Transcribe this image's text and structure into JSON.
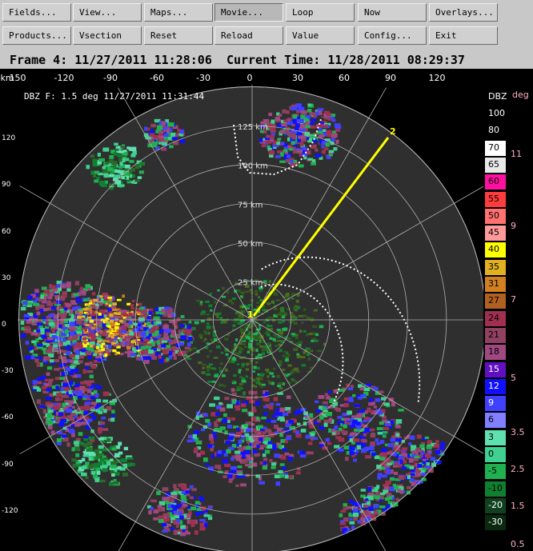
{
  "toolbar": {
    "row1": [
      "Fields...",
      "View...",
      "Maps...",
      "Movie...",
      "Loop",
      "Now",
      "Overlays..."
    ],
    "row2": [
      "Products...",
      "Vsection",
      "Reset",
      "Reload",
      "Value",
      "Config...",
      "Exit"
    ]
  },
  "frame": {
    "label": "Frame 4: 11/27/2011 11:28:06",
    "current_time": "Current Time: 11/28/2011 08:29:37"
  },
  "plot": {
    "title": "DBZ F: 1.5 deg 11/27/2011 11:31:44",
    "unit_label": "km",
    "x_ticks": [
      "150",
      "-120",
      "-90",
      "-60",
      "-30",
      "0",
      "30",
      "60",
      "90",
      "120"
    ],
    "y_ticks": [
      "120",
      "90",
      "60",
      "30",
      "0",
      "-30",
      "-60",
      "-90",
      "-120"
    ],
    "range_rings": [
      "25 km",
      "50 km",
      "75 km",
      "100 km",
      "125 km"
    ],
    "vsection_points": [
      "1",
      "2"
    ]
  },
  "legend": {
    "field": "DBZ",
    "field2": "deg",
    "entries": [
      {
        "label": "100",
        "color": "#000000",
        "text": "#ffffff"
      },
      {
        "label": "80",
        "color": "#000000",
        "text": "#ffffff"
      },
      {
        "label": "70",
        "color": "#ffffff",
        "text": "#000000"
      },
      {
        "label": "65",
        "color": "#e8e8e8",
        "text": "#000000"
      },
      {
        "label": "60",
        "color": "#ff10a0",
        "text": "#000000"
      },
      {
        "label": "55",
        "color": "#ff3c3c",
        "text": "#000000"
      },
      {
        "label": "50",
        "color": "#ff7070",
        "text": "#000000"
      },
      {
        "label": "45",
        "color": "#ff9a9a",
        "text": "#000000"
      },
      {
        "label": "40",
        "color": "#ffff00",
        "text": "#000000"
      },
      {
        "label": "35",
        "color": "#e0b020",
        "text": "#000000"
      },
      {
        "label": "31",
        "color": "#d08020",
        "text": "#000000"
      },
      {
        "label": "27",
        "color": "#b06020",
        "text": "#000000"
      },
      {
        "label": "24",
        "color": "#a03050",
        "text": "#000000"
      },
      {
        "label": "21",
        "color": "#904060",
        "text": "#000000"
      },
      {
        "label": "18",
        "color": "#a04880",
        "text": "#000000"
      },
      {
        "label": "15",
        "color": "#6010c0",
        "text": "#ffffff"
      },
      {
        "label": "12",
        "color": "#1010ff",
        "text": "#ffffff"
      },
      {
        "label": "9",
        "color": "#4040ff",
        "text": "#ffffff"
      },
      {
        "label": "6",
        "color": "#8080ff",
        "text": "#000000"
      },
      {
        "label": "3",
        "color": "#60e0b0",
        "text": "#000000"
      },
      {
        "label": "0",
        "color": "#40d090",
        "text": "#000000"
      },
      {
        "label": "-5",
        "color": "#20b050",
        "text": "#000000"
      },
      {
        "label": "-10",
        "color": "#108030",
        "text": "#000000"
      },
      {
        "label": "-20",
        "color": "#104020",
        "text": "#ffffff"
      },
      {
        "label": "-30",
        "color": "#0a2a10",
        "text": "#ffffff"
      }
    ],
    "deg_ticks": [
      "11",
      "9",
      "7",
      "5",
      "3.5",
      "2.5",
      "1.5",
      "0.5"
    ]
  },
  "colors": {
    "background": "#2f2f2f",
    "rings": "#b0b0b0",
    "vsection": "#ffff00"
  }
}
